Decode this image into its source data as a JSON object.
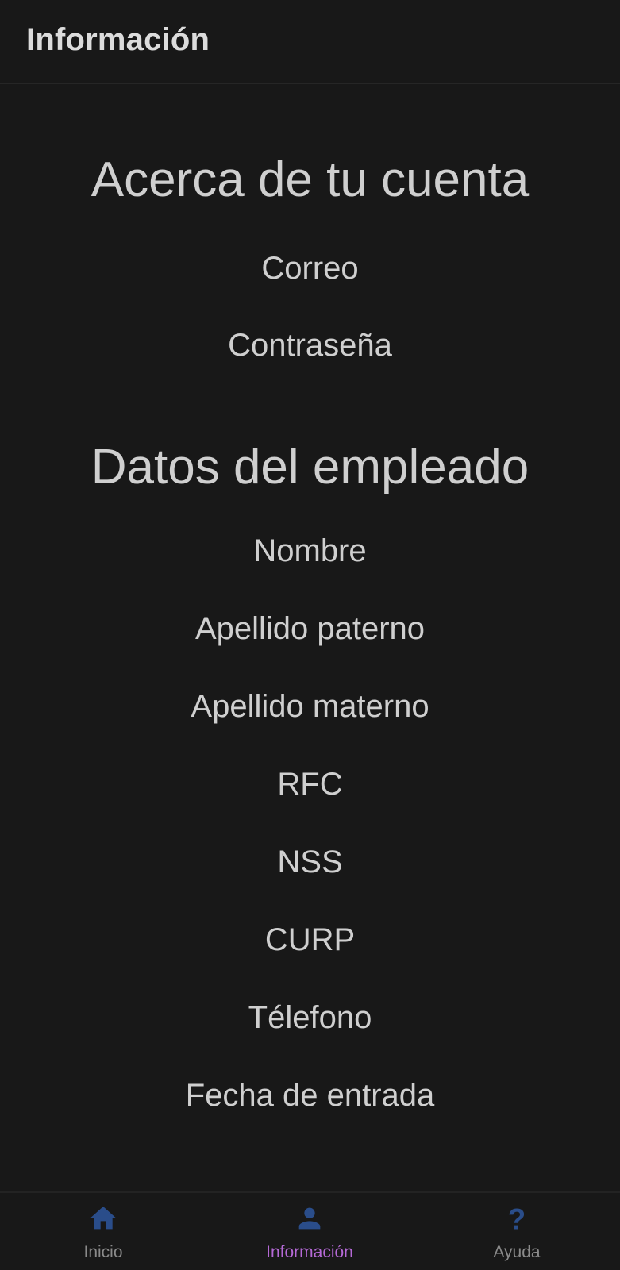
{
  "header": {
    "title": "Información"
  },
  "sections": {
    "account": {
      "title": "Acerca de tu cuenta",
      "fields": [
        "Correo",
        "Contraseña"
      ]
    },
    "employee": {
      "title": "Datos del empleado",
      "fields": [
        "Nombre",
        "Apellido paterno",
        "Apellido materno",
        "RFC",
        "NSS",
        "CURP",
        "Télefono",
        "Fecha de entrada"
      ]
    }
  },
  "tabs": [
    {
      "label": "Inicio",
      "icon": "home-icon",
      "active": false
    },
    {
      "label": "Información",
      "icon": "person-icon",
      "active": true
    },
    {
      "label": "Ayuda",
      "icon": "help-icon",
      "active": false
    }
  ],
  "colors": {
    "background": "#181818",
    "text": "#cfcfcf",
    "icon_inactive": "#2a4d8a",
    "tab_active_label": "#b569d6",
    "tab_inactive_label": "#8a8a8a"
  }
}
